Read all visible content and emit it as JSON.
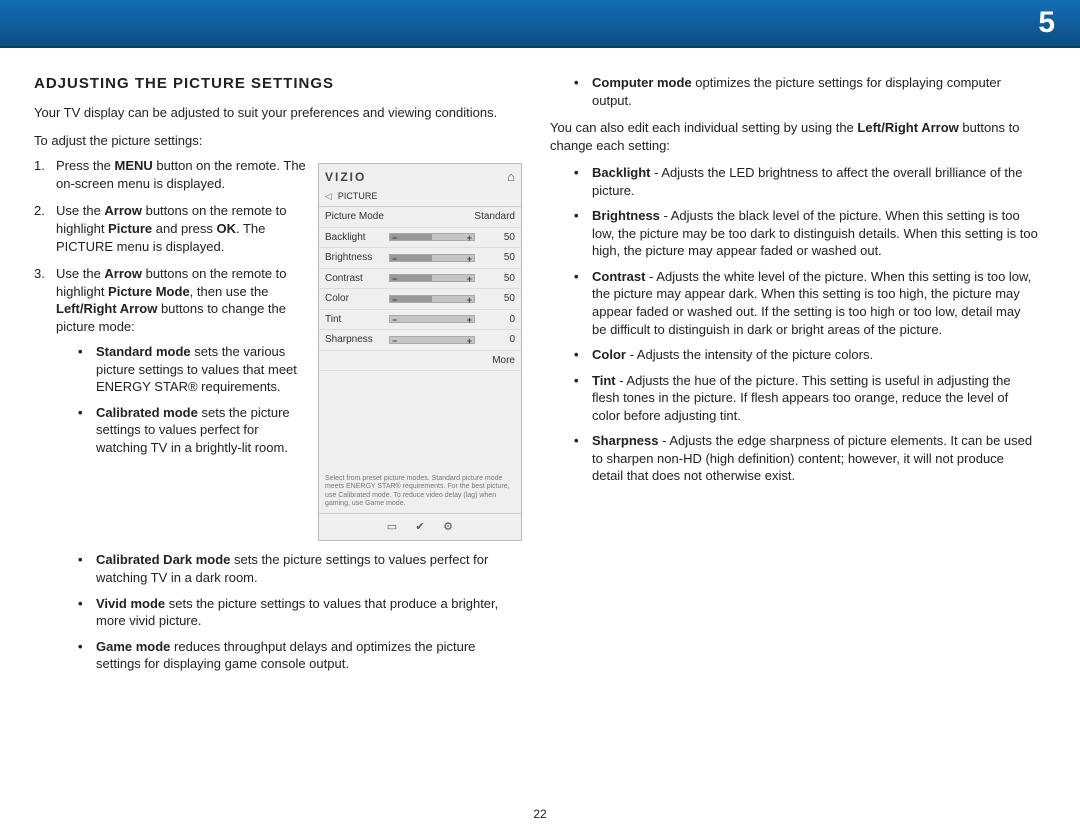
{
  "chapter_number": "5",
  "page_number": "22",
  "heading": "ADJUSTING THE PICTURE SETTINGS",
  "intro": "Your TV display can be adjusted to suit your preferences and viewing conditions.",
  "lead": "To adjust the picture settings:",
  "steps": {
    "s1_a": "Press the ",
    "s1_b": "MENU",
    "s1_c": " button on the remote. The on-screen menu is displayed.",
    "s2_a": "Use the ",
    "s2_b": "Arrow",
    "s2_c": " buttons on the remote to highlight ",
    "s2_d": "Picture",
    "s2_e": " and press ",
    "s2_f": "OK",
    "s2_g": ". The PICTURE menu is displayed.",
    "s3_a": "Use the ",
    "s3_b": "Arrow",
    "s3_c": " buttons on the remote to highlight ",
    "s3_d": "Picture Mode",
    "s3_e": ", then use the ",
    "s3_f": "Left/Right Arrow",
    "s3_g": " buttons to change the picture mode:"
  },
  "modes": {
    "standard_b": "Standard mode",
    "standard_t": " sets the various picture settings to values that meet ENERGY STAR® requirements.",
    "calibrated_b": "Calibrated mode",
    "calibrated_t": " sets the picture settings to values perfect for watching TV in a brightly-lit room.",
    "calibdark_b": "Calibrated Dark mode",
    "calibdark_t": " sets the picture settings to values perfect for watching TV in a dark room.",
    "vivid_b": "Vivid mode",
    "vivid_t": " sets the picture settings to values that produce a brighter, more vivid picture.",
    "game_b": "Game mode",
    "game_t": " reduces throughput delays and optimizes the picture settings for displaying game console output.",
    "computer_b": "Computer mode",
    "computer_t": " optimizes the picture settings for displaying computer output."
  },
  "right_intro_a": "You can also edit each individual setting by using the ",
  "right_intro_b": "Left/Right Arrow",
  "right_intro_c": " buttons to change each setting:",
  "settings": {
    "backlight_b": "Backlight",
    "backlight_t": " - Adjusts the LED brightness to affect the overall brilliance of the picture.",
    "brightness_b": "Brightness",
    "brightness_t": " - Adjusts the black level of the picture. When this setting is too low, the picture may be too dark to distinguish details. When this setting is too high, the picture may appear faded or washed out.",
    "contrast_b": "Contrast",
    "contrast_t": " - Adjusts the white level of the picture. When this setting is too low, the picture may appear dark. When this setting is too high, the picture may appear faded or washed out. If the setting is too high or too low, detail may be difficult to distinguish in dark or bright areas of the picture.",
    "color_b": "Color",
    "color_t": " - Adjusts the intensity of the picture colors.",
    "tint_b": "Tint",
    "tint_t": " - Adjusts the hue of the picture. This setting is useful in adjusting the flesh tones in the picture. If flesh appears too orange, reduce the level of color before adjusting tint.",
    "sharpness_b": "Sharpness",
    "sharpness_t": " - Adjusts the edge sharpness of picture elements. It can be used to sharpen non-HD (high definition) content; however, it will not produce detail that does not otherwise exist."
  },
  "osd": {
    "logo": "VIZIO",
    "crumb": "PICTURE",
    "rows": {
      "picture_mode_label": "Picture Mode",
      "picture_mode_value": "Standard",
      "backlight_label": "Backlight",
      "backlight_value": "50",
      "brightness_label": "Brightness",
      "brightness_value": "50",
      "contrast_label": "Contrast",
      "contrast_value": "50",
      "color_label": "Color",
      "color_value": "50",
      "tint_label": "Tint",
      "tint_value": "0",
      "sharpness_label": "Sharpness",
      "sharpness_value": "0"
    },
    "more": "More",
    "note": "Select from preset picture modes. Standard picture mode meets ENERGY STAR® requirements. For the best picture, use Calibrated mode. To reduce video delay (lag) when gaming, use Game mode."
  }
}
